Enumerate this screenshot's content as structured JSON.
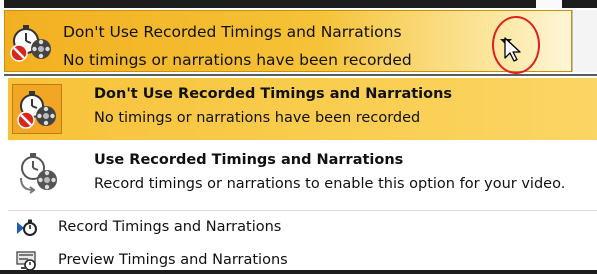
{
  "header": {
    "title": "Don't Use Recorded Timings and Narrations",
    "subtitle": "No timings or narrations have been recorded",
    "icon": "timer-no-recording-icon"
  },
  "options": [
    {
      "title": "Don't Use Recorded Timings and Narrations",
      "description": "No timings or narrations have been recorded",
      "icon": "timer-no-recording-icon",
      "selected": true
    },
    {
      "title": "Use Recorded Timings and Narrations",
      "description": "Record timings or narrations to enable this option for your video.",
      "icon": "timer-film-icon",
      "selected": false
    }
  ],
  "actions": [
    {
      "label": "Record Timings and Narrations",
      "icon": "record-timings-icon"
    },
    {
      "label": "Preview Timings and Narrations",
      "icon": "preview-timings-icon"
    }
  ],
  "colors": {
    "highlight": "#f7c23a",
    "annotation": "#e21e1e"
  }
}
